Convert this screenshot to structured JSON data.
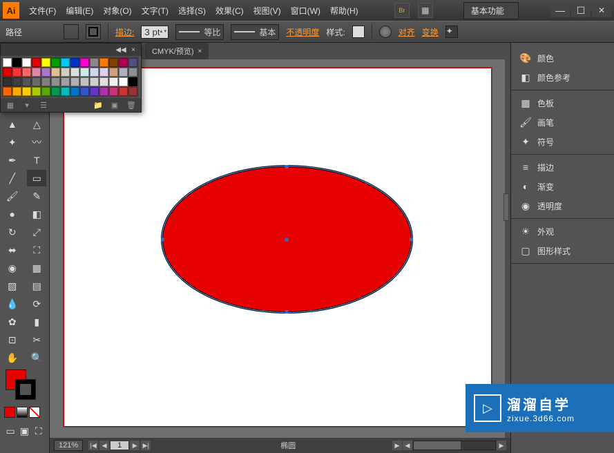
{
  "app": {
    "icon": "Ai"
  },
  "menu": {
    "file": "文件(F)",
    "edit": "编辑(E)",
    "object": "对象(O)",
    "type": "文字(T)",
    "select": "选择(S)",
    "effect": "效果(C)",
    "view": "视图(V)",
    "window": "窗口(W)",
    "help": "帮助(H)"
  },
  "workspace": {
    "label": "基本功能"
  },
  "controlbar": {
    "selection": "路径",
    "fill_color": "#e60000",
    "stroke_color": "#000000",
    "stroke_label": "描边:",
    "stroke_pt": "3 pt",
    "uniform_label": "等比",
    "basic_label": "基本",
    "opacity_label": "不透明度",
    "style_label": "样式:",
    "align_label": "对齐",
    "transform_label": "变换"
  },
  "document": {
    "tab": "CMYK/预览)",
    "zoom": "121%",
    "nav_prev_all": "|◀",
    "nav_prev": "◀",
    "page": "1",
    "nav_next": "▶",
    "nav_next_all": "▶|",
    "shape_name": "椭圆"
  },
  "panels": {
    "g1": {
      "color": "颜色",
      "color_guide": "颜色参考"
    },
    "g2": {
      "swatches": "色板",
      "brushes": "画笔",
      "symbols": "符号"
    },
    "g3": {
      "stroke": "描边",
      "gradient": "渐变",
      "transparency": "透明度"
    },
    "g4": {
      "appearance": "外观",
      "graphic_styles": "图形样式"
    }
  },
  "swatch_palette": {
    "row1": [
      "#ffffff",
      "#000000",
      "#ffffff",
      "#e60000",
      "#ffff00",
      "#00a000",
      "#00c8ff",
      "#0033cc",
      "#ff00cc",
      "#888888",
      "#ff7b00",
      "#804000",
      "#b00050",
      "#505080"
    ],
    "row2": [
      "#e60000",
      "#ff3333",
      "#ff6666",
      "#dd88aa",
      "#aa77cc",
      "#e0c090",
      "#d0d0c0",
      "#d8e0d8",
      "#d0e8e8",
      "#d0d8f0",
      "#e0d0f0",
      "#d0a080",
      "#b0b0c0",
      "#909090"
    ],
    "row3": [
      "#303030",
      "#404040",
      "#555555",
      "#6a6a6a",
      "#808080",
      "#909090",
      "#a0a0a0",
      "#b0b0b0",
      "#c0c0c0",
      "#d0d0d0",
      "#e0e0e0",
      "#f0f0f0",
      "#ffffff",
      "#000000"
    ],
    "row4": [
      "#ff6600",
      "#ffaa00",
      "#ffcc00",
      "#aacc00",
      "#55aa00",
      "#009955",
      "#00bbbb",
      "#0077cc",
      "#3355cc",
      "#6633cc",
      "#aa33aa",
      "#cc3377",
      "#cc3333",
      "#993333"
    ]
  },
  "watermark": {
    "title": "溜溜自学",
    "url": "zixue.3d66.com"
  }
}
